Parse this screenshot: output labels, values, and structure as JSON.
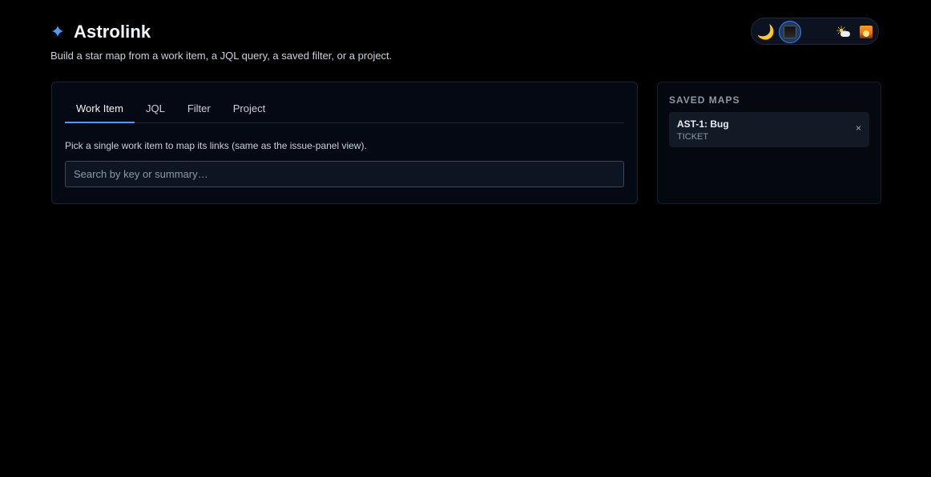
{
  "header": {
    "brand_icon": "✦",
    "title": "Astrolink",
    "tagline": "Build a star map from a work item, a JQL query, a saved filter, or a project."
  },
  "theme_switcher": {
    "options": [
      {
        "icon": "crescent-moon",
        "glyph": "🌙",
        "active": false
      },
      {
        "icon": "dark-square",
        "active": true
      },
      {
        "icon": "sun-behind-cloud",
        "glyph": "☀",
        "active": false
      },
      {
        "icon": "sunrise",
        "active": false
      }
    ]
  },
  "main": {
    "tabs": [
      {
        "label": "Work Item",
        "active": true
      },
      {
        "label": "JQL",
        "active": false
      },
      {
        "label": "Filter",
        "active": false
      },
      {
        "label": "Project",
        "active": false
      }
    ],
    "hint": "Pick a single work item to map its links (same as the issue-panel view).",
    "search": {
      "placeholder": "Search by key or summary…",
      "value": ""
    }
  },
  "saved_maps": {
    "title": "SAVED MAPS",
    "items": [
      {
        "name": "AST-1: Bug",
        "type": "TICKET",
        "remove_glyph": "×"
      }
    ]
  },
  "colors": {
    "background": "#000000",
    "accent": "#4c9aff",
    "card": "#050913"
  }
}
